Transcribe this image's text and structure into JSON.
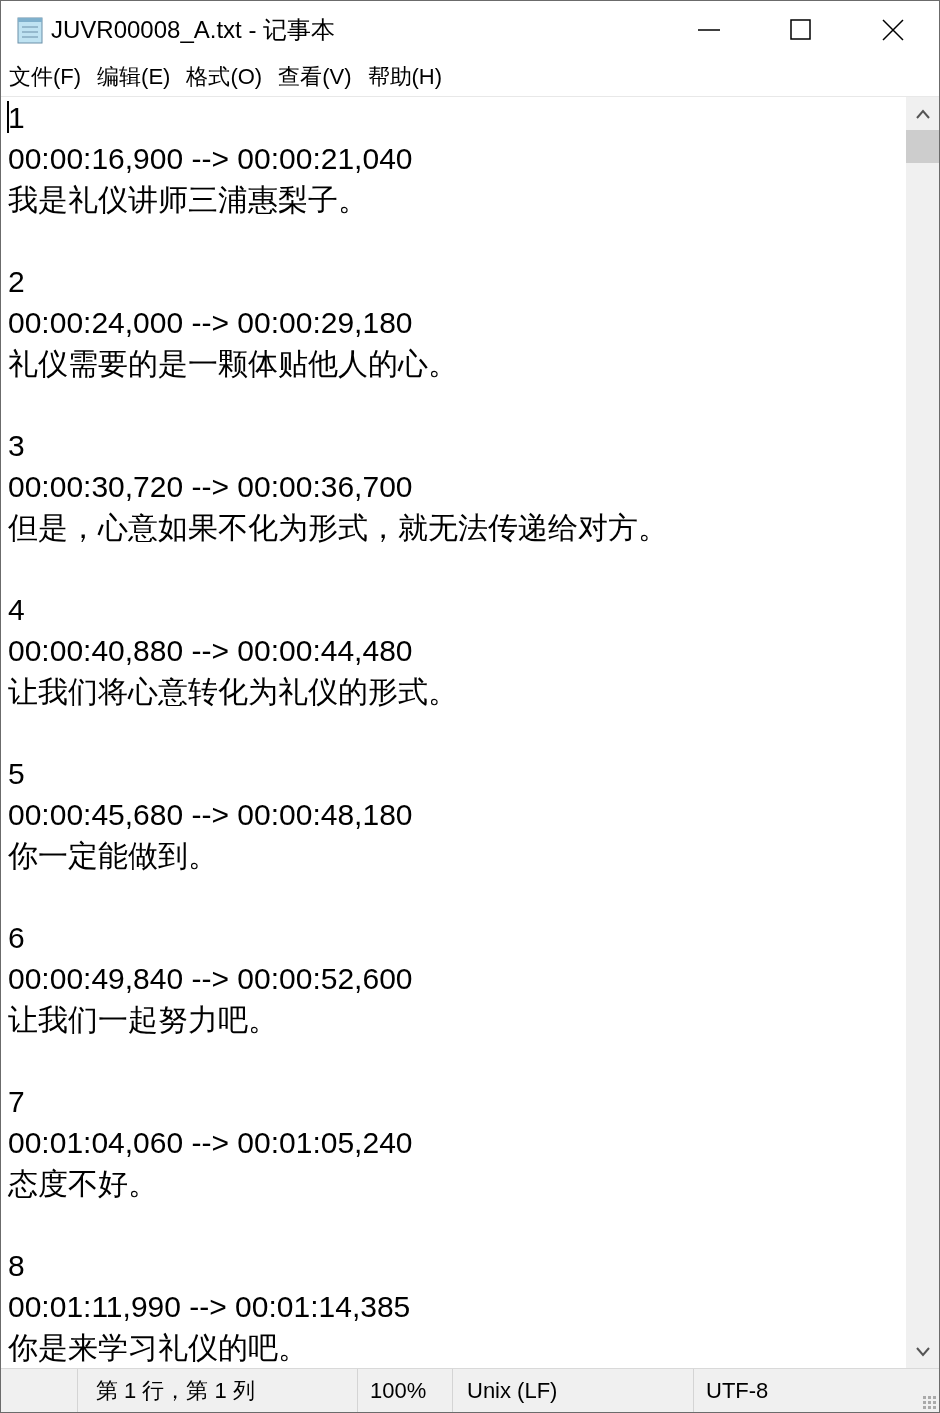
{
  "window": {
    "title": "JUVR00008_A.txt - 记事本"
  },
  "menu": [
    "文件(F)",
    "编辑(E)",
    "格式(O)",
    "查看(V)",
    "帮助(H)"
  ],
  "subtitles": [
    {
      "index": "1",
      "timing": "00:00:16,900 --> 00:00:21,040",
      "text": "我是礼仪讲师三浦惠梨子。"
    },
    {
      "index": "2",
      "timing": "00:00:24,000 --> 00:00:29,180",
      "text": "礼仪需要的是一颗体贴他人的心。"
    },
    {
      "index": "3",
      "timing": "00:00:30,720 --> 00:00:36,700",
      "text": "但是，心意如果不化为形式，就无法传递给对方。"
    },
    {
      "index": "4",
      "timing": "00:00:40,880 --> 00:00:44,480",
      "text": "让我们将心意转化为礼仪的形式。"
    },
    {
      "index": "5",
      "timing": "00:00:45,680 --> 00:00:48,180",
      "text": "你一定能做到。"
    },
    {
      "index": "6",
      "timing": "00:00:49,840 --> 00:00:52,600",
      "text": "让我们一起努力吧。"
    },
    {
      "index": "7",
      "timing": "00:01:04,060 --> 00:01:05,240",
      "text": "态度不好。"
    },
    {
      "index": "8",
      "timing": "00:01:11,990 --> 00:01:14,385",
      "text": "你是来学习礼仪的吧。"
    }
  ],
  "status_bar": {
    "position": "第 1 行，第 1 列",
    "zoom": "100%",
    "line_ending": "Unix (LF)",
    "encoding": "UTF-8"
  }
}
